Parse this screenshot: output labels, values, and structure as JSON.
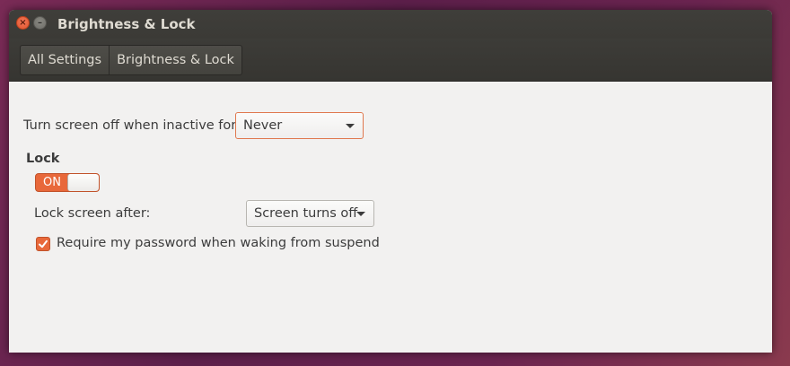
{
  "window": {
    "title": "Brightness & Lock",
    "close_icon": "close-icon",
    "minimize_icon": "minimize-icon"
  },
  "breadcrumb": {
    "items": [
      {
        "label": "All Settings"
      },
      {
        "label": "Brightness & Lock"
      }
    ]
  },
  "settings": {
    "screen_off": {
      "label": "Turn screen off when inactive for:",
      "selected": "Never"
    },
    "lock_section": {
      "title": "Lock",
      "toggle_label": "ON",
      "toggle_state": true
    },
    "lock_after": {
      "label": "Lock screen after:",
      "selected": "Screen turns off"
    },
    "require_password": {
      "label": "Require my password when waking from suspend",
      "checked": true
    }
  },
  "colors": {
    "accent": "#e8683a",
    "titlebar": "#3c3b37",
    "content_bg": "#f2f1f0"
  }
}
